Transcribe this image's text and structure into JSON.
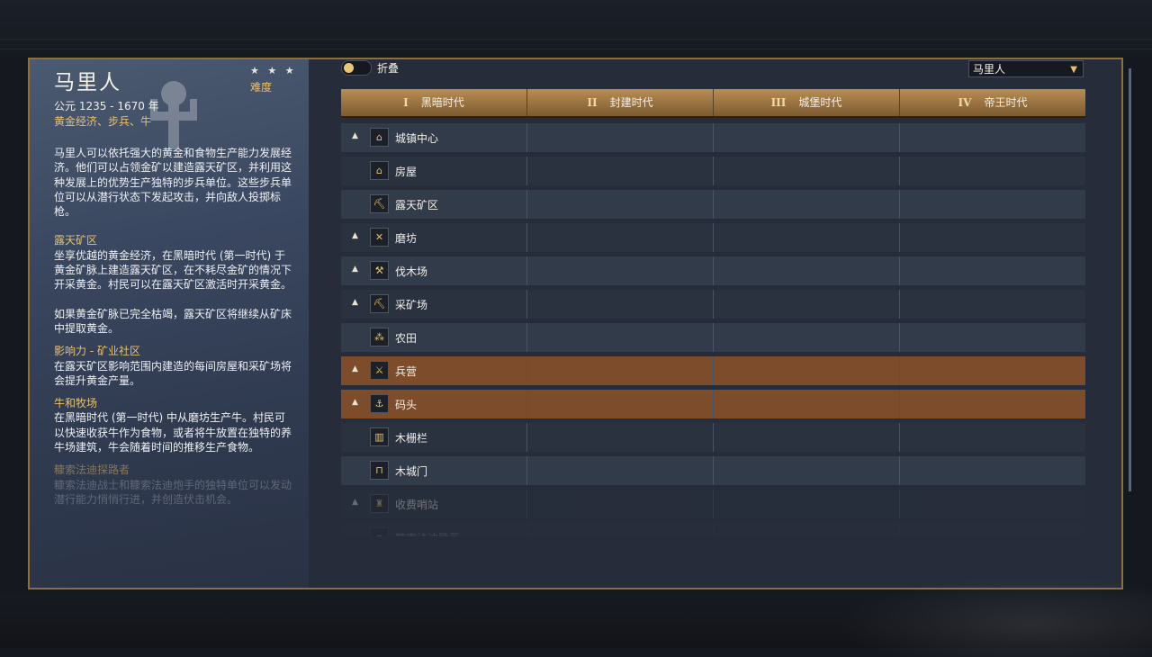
{
  "civ": {
    "name": "马里人",
    "stars": "★ ★ ★",
    "difficulty": "难度",
    "dates": "公元 1235 - 1670 年",
    "traits": "黄金经济、步兵、牛",
    "intro": "马里人可以依托强大的黄金和食物生产能力发展经济。他们可以占领金矿以建造露天矿区，并利用这种发展上的优势生产独特的步兵单位。这些步兵单位可以从潜行状态下发起攻击，并向敌人投掷标枪。",
    "sections": [
      {
        "title": "露天矿区",
        "text": "坐享优越的黄金经济，在黑暗时代 (第一时代) 于黄金矿脉上建造露天矿区，在不耗尽金矿的情况下开采黄金。村民可以在露天矿区激活时开采黄金。"
      },
      {
        "title": "",
        "text": "如果黄金矿脉已完全枯竭，露天矿区将继续从矿床中提取黄金。"
      },
      {
        "title": "影响力 - 矿业社区",
        "text": "在露天矿区影响范围内建造的每间房屋和采矿场将会提升黄金产量。"
      },
      {
        "title": "牛和牧场",
        "text": "在黑暗时代 (第一时代) 中从磨坊生产牛。村民可以快速收获牛作为食物，或者将牛放置在独特的养牛场建筑，牛会随着时间的推移生产食物。"
      },
      {
        "title": "糠索法迪探路者",
        "text": "糠索法迪战士和糠索法迪炮手的独特单位可以发动潜行能力悄悄行进，并创造伏击机会。"
      }
    ]
  },
  "toolbar": {
    "collapse_label": "折叠",
    "civ_select_value": "马里人"
  },
  "ages": [
    {
      "numeral": "I",
      "label": "黑暗时代"
    },
    {
      "numeral": "II",
      "label": "封建时代"
    },
    {
      "numeral": "III",
      "label": "城堡时代"
    },
    {
      "numeral": "IV",
      "label": "帝王时代"
    }
  ],
  "buildings": [
    {
      "name": "城镇中心",
      "icon": "town-center-icon",
      "glyph": "⌂",
      "expandable": true,
      "highlight": false
    },
    {
      "name": "房屋",
      "icon": "house-icon",
      "glyph": "⌂",
      "expandable": false,
      "highlight": false
    },
    {
      "name": "露天矿区",
      "icon": "pit-mine-icon",
      "glyph": "⛏",
      "expandable": false,
      "highlight": false
    },
    {
      "name": "磨坊",
      "icon": "mill-icon",
      "glyph": "✕",
      "expandable": true,
      "highlight": false
    },
    {
      "name": "伐木场",
      "icon": "lumber-camp-icon",
      "glyph": "⚒",
      "expandable": true,
      "highlight": false
    },
    {
      "name": "采矿场",
      "icon": "mining-camp-icon",
      "glyph": "⛏",
      "expandable": true,
      "highlight": false
    },
    {
      "name": "农田",
      "icon": "farm-icon",
      "glyph": "⁂",
      "expandable": false,
      "highlight": false
    },
    {
      "name": "兵营",
      "icon": "barracks-icon",
      "glyph": "⚔",
      "expandable": true,
      "highlight": true
    },
    {
      "name": "码头",
      "icon": "dock-anchor-icon",
      "glyph": "⚓",
      "expandable": true,
      "highlight": true
    },
    {
      "name": "木栅栏",
      "icon": "palisade-wall-icon",
      "glyph": "▥",
      "expandable": false,
      "highlight": false
    },
    {
      "name": "木城门",
      "icon": "palisade-gate-icon",
      "glyph": "⊓",
      "expandable": false,
      "highlight": false
    },
    {
      "name": "收费哨站",
      "icon": "toll-outpost-icon",
      "glyph": "♜",
      "expandable": true,
      "highlight": false
    },
    {
      "name": "糠索法迪隐蔽",
      "icon": "hidden-building-icon",
      "glyph": "▪",
      "expandable": false,
      "highlight": false
    }
  ],
  "colors": {
    "accent_gold": "#e6c072",
    "frame_border": "#8d6e3f",
    "highlight_row": "#7c4c2b"
  }
}
